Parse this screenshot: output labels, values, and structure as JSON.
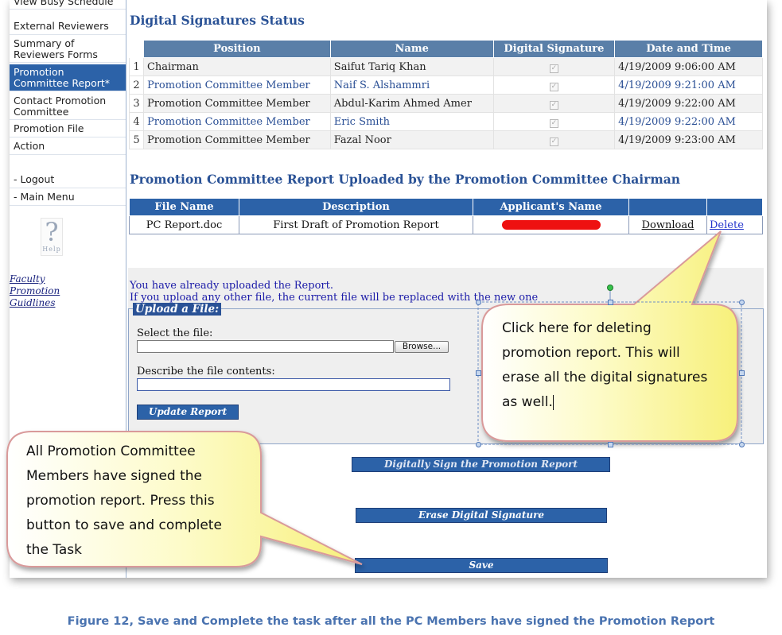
{
  "sidebar": {
    "items": [
      {
        "label": "View Busy Schedule"
      },
      {
        "label": "External Reviewers"
      },
      {
        "label": "Summary of Reviewers Forms"
      },
      {
        "label": "Promotion Committee Report*"
      },
      {
        "label": "Contact Promotion Committee"
      },
      {
        "label": "Promotion File"
      },
      {
        "label": "Action"
      },
      {
        "label": "- Logout"
      },
      {
        "label": "- Main Menu"
      }
    ],
    "help_label": "Help",
    "guidelines_link": "Faculty Promotion Guidlines"
  },
  "signatures": {
    "title": "Digital Signatures Status",
    "columns": [
      "Position",
      "Name",
      "Digital Signature",
      "Date and Time"
    ],
    "rows": [
      {
        "num": "1",
        "position": "Chairman",
        "name": "Saifut Tariq Khan",
        "signed": true,
        "datetime": "4/19/2009 9:06:00 AM"
      },
      {
        "num": "2",
        "position": "Promotion Committee Member",
        "name": "Naif S. Alshammri",
        "signed": true,
        "datetime": "4/19/2009 9:21:00 AM"
      },
      {
        "num": "3",
        "position": "Promotion Committee Member",
        "name": "Abdul-Karim Ahmed Amer",
        "signed": true,
        "datetime": "4/19/2009 9:22:00 AM"
      },
      {
        "num": "4",
        "position": "Promotion Committee Member",
        "name": "Eric Smith",
        "signed": true,
        "datetime": "4/19/2009 9:22:00 AM"
      },
      {
        "num": "5",
        "position": "Promotion Committee Member",
        "name": "Fazal Noor",
        "signed": true,
        "datetime": "4/19/2009 9:23:00 AM"
      }
    ],
    "check_glyph": "✓"
  },
  "report": {
    "title": "Promotion Committee Report Uploaded by the Promotion Committee Chairman",
    "columns": [
      "File Name",
      "Description",
      "Applicant's Name",
      "",
      ""
    ],
    "row": {
      "file_name": "PC Report.doc",
      "description": "First Draft of Promotion Report",
      "download_label": "Download",
      "delete_label": "Delete"
    }
  },
  "upload": {
    "notice_line1": "You have already uploaded the Report.",
    "notice_line2": "If you upload any other file, the current file will be replaced with the new one",
    "legend": "Upload a File:",
    "select_label": "Select the file:",
    "browse_label": "Browse...",
    "describe_label": "Describe the file contents:",
    "update_button": "Update Report"
  },
  "actions": {
    "sign_button": "Digitally Sign the Promotion Report",
    "erase_button": "Erase Digital Signature",
    "save_button": "Save"
  },
  "callouts": {
    "delete_note": [
      "Click here for deleting",
      "promotion report. This will",
      "erase all the digital signatures",
      "as well."
    ],
    "save_note": [
      "All Promotion Committee",
      "Members have signed the",
      "promotion report. Press this",
      "button to save and complete",
      "the Task"
    ]
  },
  "caption": "Figure 12, Save and Complete the task after all the PC Members have signed the Promotion Report",
  "colors": {
    "accent": "#2c62a8",
    "table_header": "#5a7fa8",
    "callout_fill": "#fbf79a",
    "callout_border": "#d99a9a",
    "caption": "#4a73b0"
  }
}
